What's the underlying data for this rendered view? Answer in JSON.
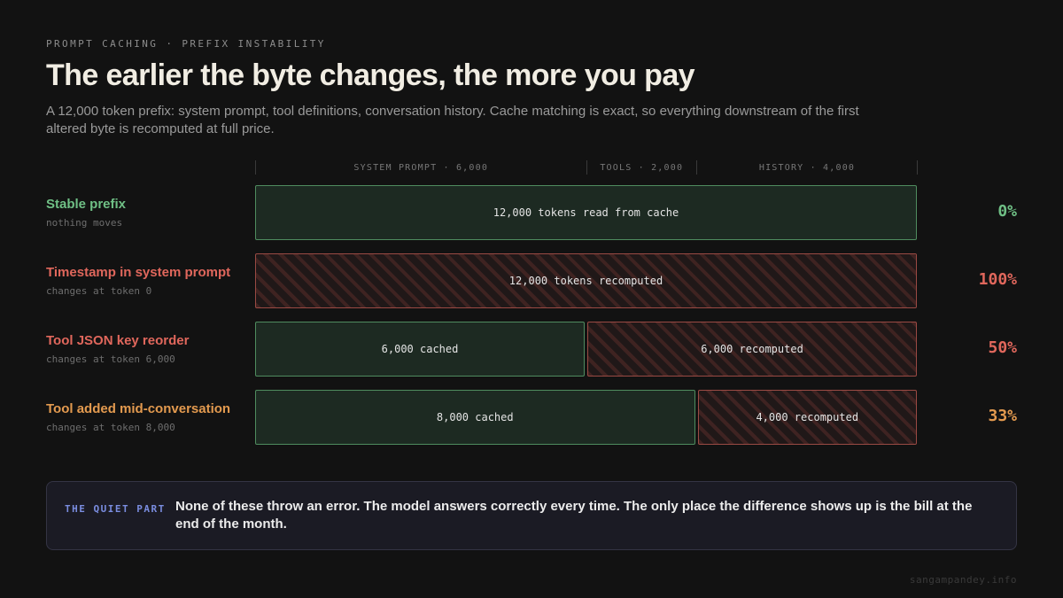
{
  "kicker": "PROMPT CACHING · PREFIX INSTABILITY",
  "title": "The earlier the byte changes, the more you pay",
  "subtitle": "A 12,000 token prefix: system prompt, tool definitions, conversation history. Cache matching is exact, so everything downstream of the first altered byte is recomputed at full price.",
  "columns": [
    {
      "label": "SYSTEM PROMPT · 6,000",
      "tokens": 6000
    },
    {
      "label": "TOOLS · 2,000",
      "tokens": 2000
    },
    {
      "label": "HISTORY · 4,000",
      "tokens": 4000
    }
  ],
  "colors": {
    "cached_border": "#4f8c5f",
    "recomputed_border": "#9a4a44",
    "green": "#6fbf85",
    "red": "#e0675c",
    "orange": "#e39a4f",
    "accent_blue": "#7a8de0"
  },
  "rows": [
    {
      "title": "Stable prefix",
      "subtitle": "nothing moves",
      "title_color": "#6fbf85",
      "segments": [
        {
          "kind": "cached",
          "tokens": 12000,
          "label": "12,000 tokens read from cache"
        }
      ],
      "percent": "0%",
      "percent_color": "#6fbf85"
    },
    {
      "title": "Timestamp in system prompt",
      "subtitle": "changes at token 0",
      "title_color": "#e0675c",
      "segments": [
        {
          "kind": "recomputed",
          "tokens": 12000,
          "label": "12,000 tokens recomputed"
        }
      ],
      "percent": "100%",
      "percent_color": "#e0675c"
    },
    {
      "title": "Tool JSON key reorder",
      "subtitle": "changes at token 6,000",
      "title_color": "#e0675c",
      "segments": [
        {
          "kind": "cached",
          "tokens": 6000,
          "label": "6,000 cached"
        },
        {
          "kind": "recomputed",
          "tokens": 6000,
          "label": "6,000 recomputed"
        }
      ],
      "percent": "50%",
      "percent_color": "#e0675c"
    },
    {
      "title": "Tool added mid-conversation",
      "subtitle": "changes at token 8,000",
      "title_color": "#e39a4f",
      "segments": [
        {
          "kind": "cached",
          "tokens": 8000,
          "label": "8,000 cached"
        },
        {
          "kind": "recomputed",
          "tokens": 4000,
          "label": "4,000 recomputed"
        }
      ],
      "percent": "33%",
      "percent_color": "#e39a4f"
    }
  ],
  "callout": {
    "tag": "THE QUIET PART",
    "text": "None of these throw an error. The model answers correctly every time. The only place the difference shows up is the bill at the end of the month."
  },
  "footer": "sangampandey.info"
}
